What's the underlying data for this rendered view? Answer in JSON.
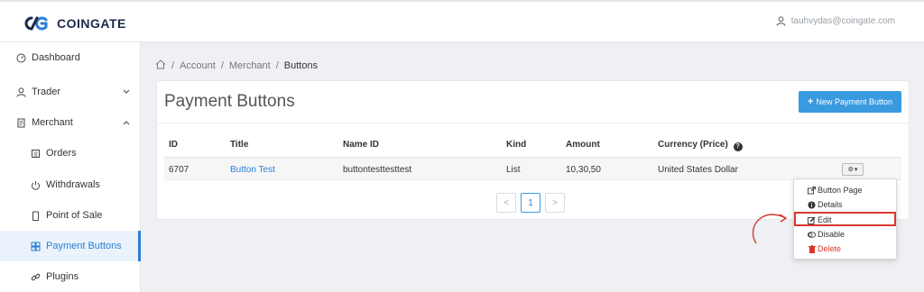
{
  "header": {
    "brand": "COINGATE",
    "user_email": "tauhvydas@coingate.com"
  },
  "sidebar": {
    "items": [
      {
        "label": "Dashboard"
      },
      {
        "label": "Trader"
      },
      {
        "label": "Merchant"
      },
      {
        "label": "Orders"
      },
      {
        "label": "Withdrawals"
      },
      {
        "label": "Point of Sale"
      },
      {
        "label": "Payment Buttons"
      },
      {
        "label": "Plugins"
      }
    ]
  },
  "breadcrumb": {
    "items": [
      "Account",
      "Merchant",
      "Buttons"
    ],
    "separator": "/"
  },
  "panel": {
    "title": "Payment Buttons",
    "new_button_label": "New Payment Button"
  },
  "table": {
    "headers": [
      "ID",
      "Title",
      "Name ID",
      "Kind",
      "Amount",
      "Currency (Price)"
    ],
    "rows": [
      {
        "id": "6707",
        "title": "Button Test",
        "name_id": "buttontesttesttest",
        "kind": "List",
        "amount": "10,30,50",
        "currency": "United States Dollar"
      }
    ]
  },
  "pagination": {
    "prev": "<",
    "current": "1",
    "next": ">"
  },
  "dropdown": {
    "items": [
      {
        "label": "Button Page"
      },
      {
        "label": "Details"
      },
      {
        "label": "Edit"
      },
      {
        "label": "Disable"
      },
      {
        "label": "Delete"
      }
    ]
  },
  "colors": {
    "accent": "#3a9ae0",
    "active_nav_bg": "#eaf3fc",
    "danger": "#d9382e",
    "brand": "#1b2a4a"
  }
}
